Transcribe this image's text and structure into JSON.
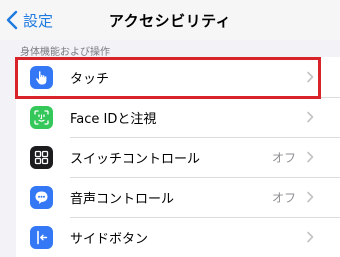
{
  "navbar": {
    "back_label": "設定",
    "title": "アクセシビリティ"
  },
  "section": {
    "header": "身体機能および操作",
    "items": [
      {
        "label": "タッチ",
        "value": "",
        "icon": "hand-pointer-icon",
        "icon_color": "#3478f6"
      },
      {
        "label": "Face IDと注視",
        "value": "",
        "icon": "face-id-icon",
        "icon_color": "#34c759"
      },
      {
        "label": "スイッチコントロール",
        "value": "オフ",
        "icon": "switch-control-icon",
        "icon_color": "#1c1c1e"
      },
      {
        "label": "音声コントロール",
        "value": "オフ",
        "icon": "voice-control-icon",
        "icon_color": "#3478f6"
      },
      {
        "label": "サイドボタン",
        "value": "",
        "icon": "side-button-icon",
        "icon_color": "#3478f6"
      }
    ]
  },
  "colors": {
    "accent": "#1f7ae0",
    "highlight_border": "#d8232a"
  }
}
